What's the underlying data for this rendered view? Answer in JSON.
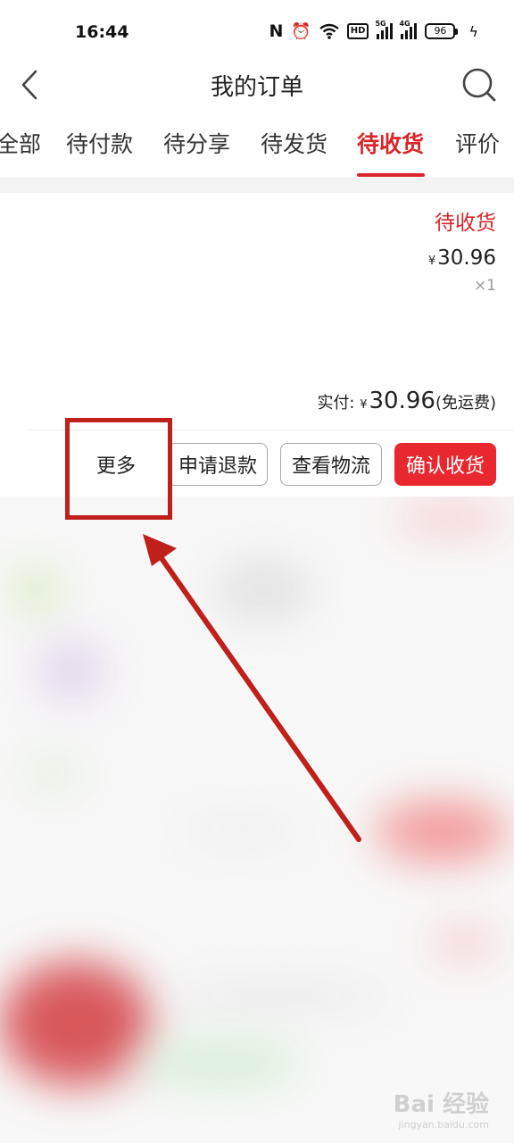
{
  "status_bar": {
    "time": "16:44",
    "nfc": "N",
    "alarm": "⏰",
    "hd": "HD",
    "sig1_tag": "5G",
    "sig2_tag": "4G",
    "battery": "96",
    "charging": "ϟ"
  },
  "header": {
    "title": "我的订单",
    "back_icon": "chevron-left-icon",
    "search_icon": "search-icon"
  },
  "tabs": [
    {
      "label": "全部"
    },
    {
      "label": "待付款"
    },
    {
      "label": "待分享"
    },
    {
      "label": "待发货"
    },
    {
      "label": "待收货",
      "active": true
    },
    {
      "label": "评价"
    }
  ],
  "order": {
    "status": "待收货",
    "currency": "¥",
    "price": "30.96",
    "quantity": "×1",
    "paid_label": "实付: ",
    "paid_amount": "30.96",
    "shipping_note": "(免运费)",
    "actions": {
      "more": "更多",
      "refund": "申请退款",
      "logistics": "查看物流",
      "confirm": "确认收货"
    }
  },
  "watermark": {
    "main": "Bai 经验",
    "sub": "jingyan.baidu.com"
  },
  "colors": {
    "accent": "#d8262b",
    "confirm_button": "#e8282e",
    "annotation": "#c0201a"
  }
}
